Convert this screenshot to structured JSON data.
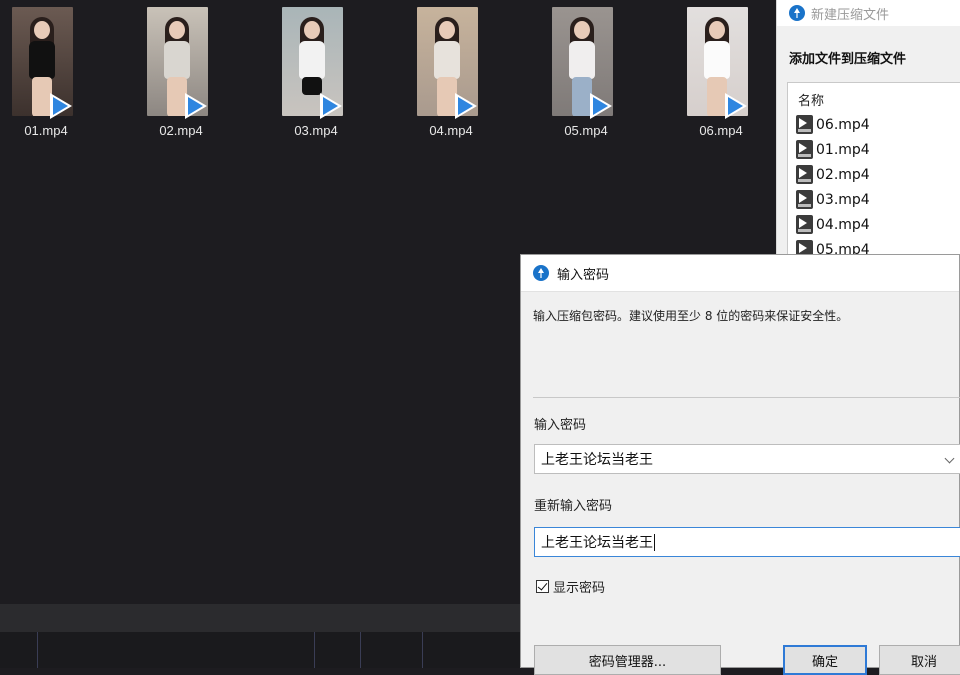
{
  "explorer": {
    "files": [
      {
        "name": "01.mp4",
        "thumb_colors": [
          "#6b5a52",
          "#1b1b1b"
        ]
      },
      {
        "name": "02.mp4",
        "thumb_colors": [
          "#c9c2b8",
          "#6d6a67"
        ]
      },
      {
        "name": "03.mp4",
        "thumb_colors": [
          "#a9b5b8",
          "#f2f2f2"
        ]
      },
      {
        "name": "04.mp4",
        "thumb_colors": [
          "#c7b39c",
          "#b8a9a4"
        ]
      },
      {
        "name": "05.mp4",
        "thumb_colors": [
          "#9a9490",
          "#9bb0c8"
        ]
      },
      {
        "name": "06.mp4",
        "thumb_colors": [
          "#e2dfde",
          "#f4f1ee"
        ]
      }
    ]
  },
  "archive_window": {
    "title": "新建压缩文件",
    "heading": "添加文件到压缩文件",
    "column_header": "名称",
    "files": [
      "06.mp4",
      "01.mp4",
      "02.mp4",
      "03.mp4",
      "04.mp4",
      "05.mp4"
    ]
  },
  "password_dialog": {
    "title": "输入密码",
    "description": "输入压缩包密码。建议使用至少 8 位的密码来保证安全性。",
    "password_label": "输入密码",
    "password_value": "上老王论坛当老王",
    "confirm_label": "重新输入密码",
    "confirm_value": "上老王论坛当老王",
    "show_password_label": "显示密码",
    "show_password_checked": true,
    "manager_button": "密码管理器...",
    "ok_button": "确定",
    "cancel_button": "取消"
  },
  "colors": {
    "desktop_bg": "#1d1c20",
    "accent": "#2f7ad6",
    "dialog_bg": "#f0f0f0"
  }
}
